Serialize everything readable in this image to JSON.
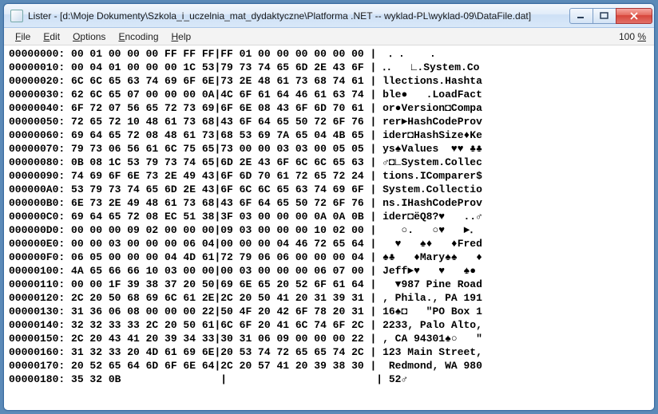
{
  "window": {
    "title": "Lister - [d:\\Moje Dokumenty\\Szkola_i_uczelnia_mat_dydaktyczne\\Platforma .NET -- wyklad-PL\\wyklad-09\\DataFile.dat]"
  },
  "menu": {
    "file": "File",
    "edit": "Edit",
    "options": "Options",
    "encoding": "Encoding",
    "help": "Help",
    "zoom": "100 %"
  },
  "hex": {
    "lines": [
      "00000000: 00 01 00 00 00 FF FF FF|FF 01 00 00 00 00 00 00 |  ․ .    .      ",
      "00000010: 00 04 01 00 00 00 1C 53|79 73 74 65 6D 2E 43 6F | ․.   ∟.System.Co",
      "00000020: 6C 6C 65 63 74 69 6F 6E|73 2E 48 61 73 68 74 61 | llections.Hashta",
      "00000030: 62 6C 65 07 00 00 00 0A|4C 6F 61 64 46 61 63 74 | ble●   .LoadFact",
      "00000040: 6F 72 07 56 65 72 73 69|6F 6E 08 43 6F 6D 70 61 | or●Version◘Compa",
      "00000050: 72 65 72 10 48 61 73 68|43 6F 64 65 50 72 6F 76 | rer►HashCodeProv",
      "00000060: 69 64 65 72 08 48 61 73|68 53 69 7A 65 04 4B 65 | ider◘HashSize♦Ke",
      "00000070: 79 73 06 56 61 6C 75 65|73 00 00 03 03 00 05 05 | ys♠Values  ♥♥ ♣♣",
      "00000080: 0B 08 1C 53 79 73 74 65|6D 2E 43 6F 6C 6C 65 63 | ♂◘∟System.Collec",
      "00000090: 74 69 6F 6E 73 2E 49 43|6F 6D 70 61 72 65 72 24 | tions.IComparer$",
      "000000A0: 53 79 73 74 65 6D 2E 43|6F 6C 6C 65 63 74 69 6F | System.Collectio",
      "000000B0: 6E 73 2E 49 48 61 73 68|43 6F 64 65 50 72 6F 76 | ns.IHashCodeProv",
      "000000C0: 69 64 65 72 08 EC 51 38|3F 03 00 00 00 0A 0A 0B | ider◘ëQ8?♥   ..♂",
      "000000D0: 00 00 00 09 02 00 00 00|09 03 00 00 00 10 02 00 |    ○.   ○♥   ►․ ",
      "000000E0: 00 00 03 00 00 00 06 04|00 00 00 04 46 72 65 64 |   ♥   ♠♦   ♦Fred",
      "000000F0: 06 05 00 00 00 04 4D 61|72 79 06 06 00 00 00 04 | ♠♣   ♦Mary♠♠   ♦",
      "00000100: 4A 65 66 66 10 03 00 00|00 03 00 00 00 06 07 00 | Jeff►♥   ♥   ♠● ",
      "00000110: 00 00 1F 39 38 37 20 50|69 6E 65 20 52 6F 61 64 |   ▼987 Pine Road",
      "00000120: 2C 20 50 68 69 6C 61 2E|2C 20 50 41 20 31 39 31 | , Phila., PA 191",
      "00000130: 31 36 06 08 00 00 00 22|50 4F 20 42 6F 78 20 31 | 16♠◘   \"PO Box 1",
      "00000140: 32 32 33 33 2C 20 50 61|6C 6F 20 41 6C 74 6F 2C | 2233, Palo Alto,",
      "00000150: 2C 20 43 41 20 39 34 33|30 31 06 09 00 00 00 22 | , CA 94301♠○   \"",
      "00000160: 31 32 33 20 4D 61 69 6E|20 53 74 72 65 65 74 2C | 123 Main Street,",
      "00000170: 20 52 65 64 6D 6F 6E 64|2C 20 57 41 20 39 38 30 |  Redmond, WA 980",
      "00000180: 35 32 0B                |                        | 52♂"
    ]
  }
}
